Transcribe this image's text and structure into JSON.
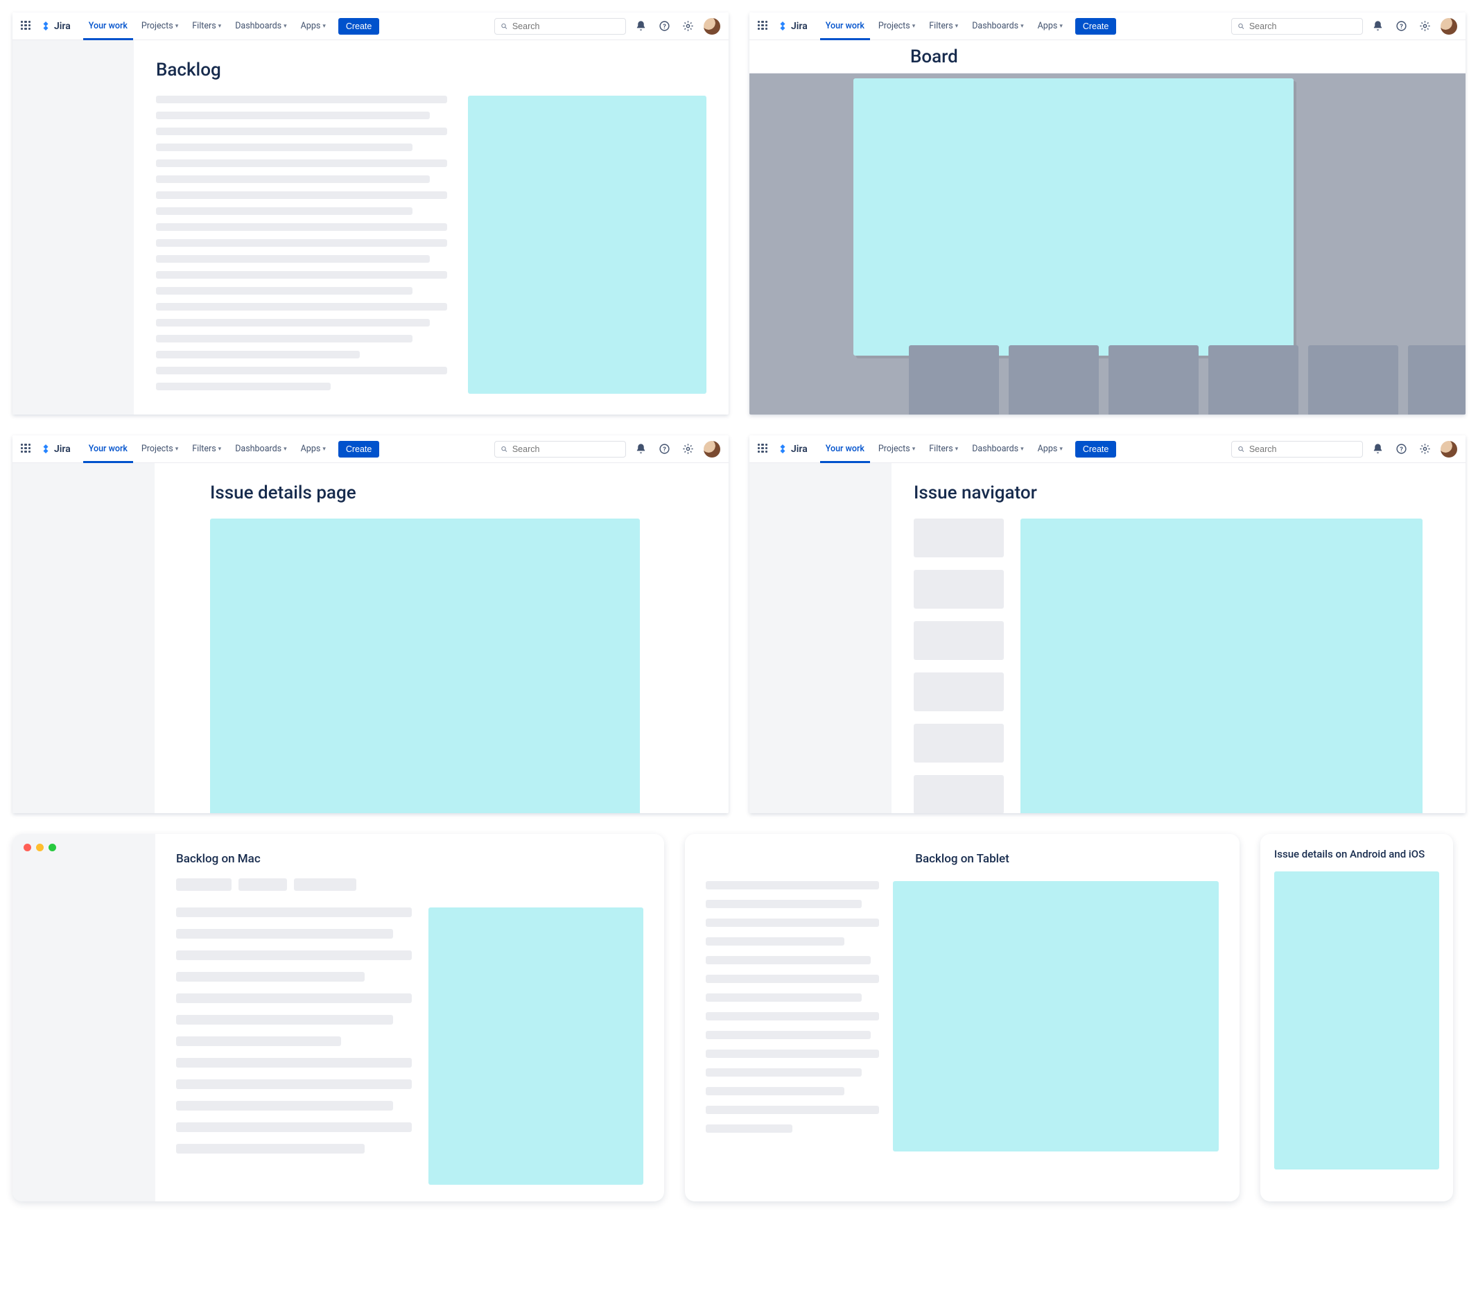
{
  "nav": {
    "product": "Jira",
    "items": {
      "your_work": "Your work",
      "projects": "Projects",
      "filters": "Filters",
      "dashboards": "Dashboards",
      "apps": "Apps"
    },
    "create": "Create",
    "search_placeholder": "Search"
  },
  "cards": {
    "backlog": {
      "title": "Backlog"
    },
    "board": {
      "title": "Board"
    },
    "issue_details": {
      "title": "Issue details page"
    },
    "issue_navigator": {
      "title": "Issue navigator"
    },
    "mac": {
      "title": "Backlog on Mac"
    },
    "tablet": {
      "title": "Backlog on Tablet"
    },
    "phone": {
      "title": "Issue details on Android and iOS"
    }
  },
  "colors": {
    "highlight": "#b8f1f4",
    "skeleton": "#ebecf0",
    "primary": "#0052cc"
  }
}
